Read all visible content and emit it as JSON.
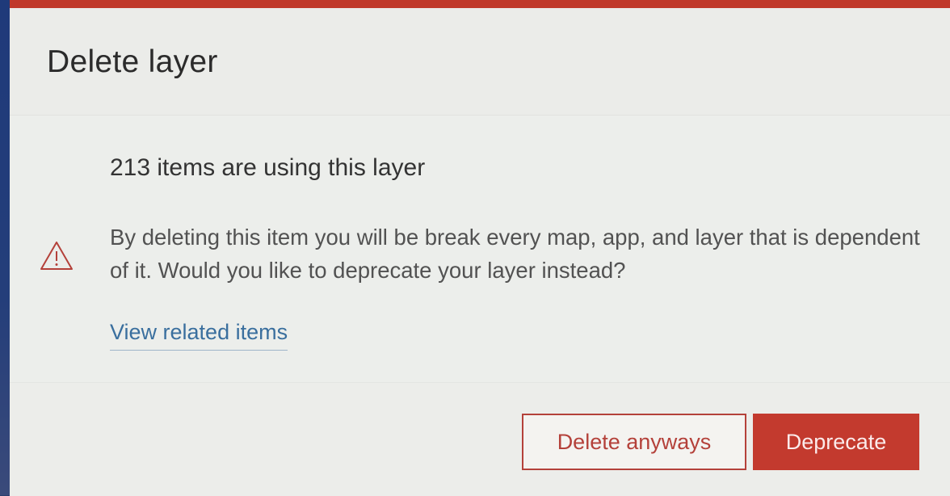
{
  "dialog": {
    "title": "Delete layer",
    "accent_color": "#c0392b"
  },
  "body": {
    "heading": "213 items are using this layer",
    "icon": "warning-triangle-icon",
    "message": "By deleting this item you will be break every map, app, and layer that is dependent of it. Would you like to deprecate your layer instead?",
    "link_label": "View related items"
  },
  "footer": {
    "secondary_label": "Delete anyways",
    "primary_label": "Deprecate"
  }
}
